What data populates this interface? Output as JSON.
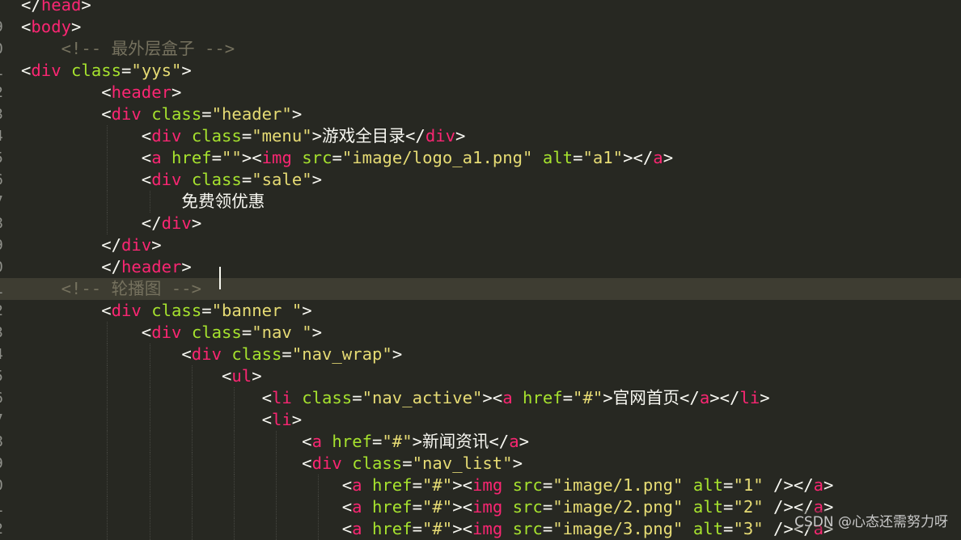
{
  "editor": {
    "theme_colors": {
      "background": "#272822",
      "tag": "#f92672",
      "attribute": "#a6e22e",
      "string": "#e6db74",
      "comment": "#75715e",
      "text": "#f8f8f2",
      "current_line": "#3e3d32"
    },
    "line_numbers": [
      "9",
      "0",
      "1",
      "2",
      "3",
      "4",
      "5",
      "6",
      "7",
      "8",
      "9",
      "0",
      "1",
      "2",
      "3",
      "4",
      "5",
      "6",
      "7",
      "8",
      "9",
      "0",
      "1",
      "2"
    ],
    "lines": [
      "</head>",
      "<body>",
      "    <!-- 最外层盒子 -->",
      "<div class=\"yys\">",
      "        <header>",
      "        <div class=\"header\">",
      "            <div class=\"menu\">游戏全目录</div>",
      "            <a href=\"\"><img src=\"image/logo_a1.png\" alt=\"a1\"></a>",
      "            <div class=\"sale\">",
      "                免费领优惠",
      "            </div>",
      "        </div>",
      "        </header>",
      "    <!-- 轮播图 -->",
      "        <div class=\"banner \">",
      "            <div class=\"nav \">",
      "                <div class=\"nav_wrap\">",
      "                    <ul>",
      "                        <li class=\"nav_active\"><a href=\"#\">官网首页</a></li>",
      "                        <li>",
      "                            <a href=\"#\">新闻资讯</a>",
      "                            <div class=\"nav_list\">",
      "                                <a href=\"#\"><img src=\"image/1.png\" alt=\"1\" /></a>",
      "                                <a href=\"#\"><img src=\"image/2.png\" alt=\"2\" /></a>",
      "                                <a href=\"#\"><img src=\"image/3.png\" alt=\"3\" /></a>"
    ],
    "current_line_index": 13
  },
  "watermark": "CSDN @心态还需努力呀"
}
